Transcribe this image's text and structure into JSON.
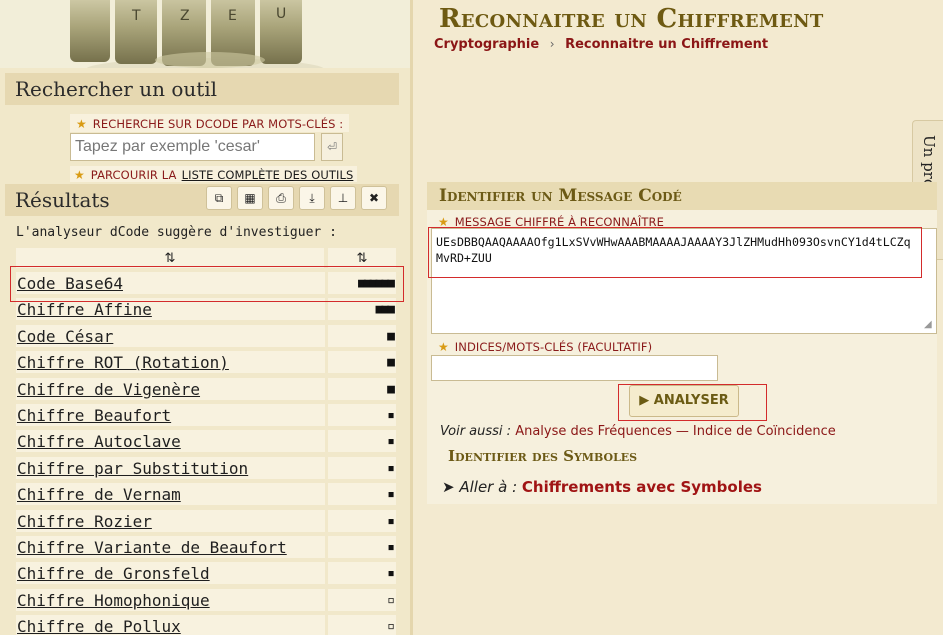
{
  "page": {
    "title": "Reconnaitre un Chiffrement",
    "breadcrumb": [
      "Cryptographie",
      "Reconnaitre un Chiffrement"
    ]
  },
  "left": {
    "search_section_title": "Rechercher un outil",
    "keyword_label": "RECHERCHE SUR DCODE PAR MOTS-CLÉS :",
    "search_placeholder": "Tapez par exemple 'cesar'",
    "enter_icon": "return-key-icon",
    "browse_prefix": "PARCOURIR LA",
    "browse_link": "LISTE COMPLÈTE DES OUTILS",
    "results_title": "Résultats",
    "toolbar_icons": [
      "copy-icon",
      "calculator-icon",
      "print-icon",
      "download-icon",
      "pin-icon",
      "close-icon"
    ],
    "analyser_note": "L'analyseur dCode suggère d'investiguer :",
    "sort_symbol": "⇅",
    "results": [
      {
        "name": "Code Base64",
        "score": "■■■■■■"
      },
      {
        "name": "Chiffre Affine",
        "score": "■■■"
      },
      {
        "name": "Code César",
        "score": "■"
      },
      {
        "name": "Chiffre ROT (Rotation)",
        "score": "■"
      },
      {
        "name": "Chiffre de Vigenère",
        "score": "■"
      },
      {
        "name": "Chiffre Beaufort",
        "score": "▪"
      },
      {
        "name": "Chiffre Autoclave",
        "score": "▪"
      },
      {
        "name": "Chiffre par Substitution",
        "score": "▪"
      },
      {
        "name": "Chiffre de Vernam",
        "score": "▪"
      },
      {
        "name": "Chiffre Rozier",
        "score": "▪"
      },
      {
        "name": "Chiffre Variante de Beaufort",
        "score": "▪"
      },
      {
        "name": "Chiffre de Gronsfeld",
        "score": "▪"
      },
      {
        "name": "Chiffre Homophonique",
        "score": "▫"
      },
      {
        "name": "Chiffre de Pollux",
        "score": "▫"
      }
    ]
  },
  "main": {
    "panel_title": "Identifier un Message Codé",
    "message_label": "MESSAGE CHIFFRÉ À RECONNAÎTRE",
    "message_value": "UEsDBBQAAQAAAAOfg1LxSVvWHwAAABMAAAAJAAAAY3JlZHMudHh093OsvnCY1d4tLCZqMvRD+ZUU",
    "hints_label": "INDICES/MOTS-CLÉS (FACULTATIF)",
    "hints_value": "",
    "analyse_button": "ANALYSER",
    "see_also_prefix": "Voir aussi :",
    "see_also_links": [
      "Analyse des Fréquences",
      "Indice de Coïncidence"
    ],
    "symbols_title": "Identifier des Symboles",
    "goto_prefix": "Aller à :",
    "goto_link": "Chiffrements avec Symboles",
    "side_tab": "Un problème ?"
  },
  "colors": {
    "accent_red": "#8b1616",
    "title_gold": "#6e5a12",
    "highlight_outline": "#d32b2b"
  }
}
